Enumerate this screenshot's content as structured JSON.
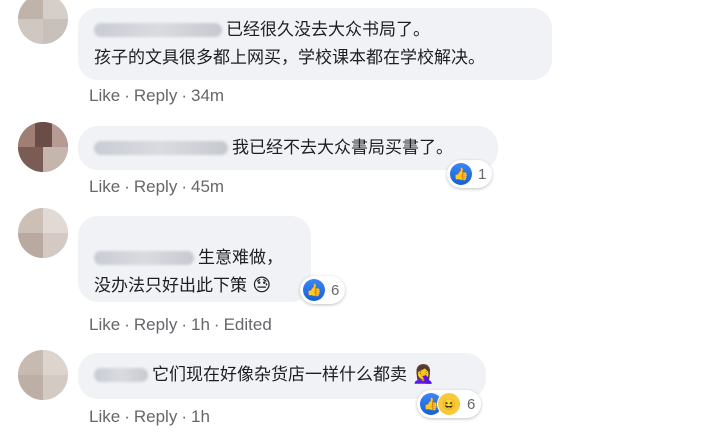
{
  "comments": [
    {
      "text_lines": [
        "已经很久没去大众书局了。",
        "孩子的文具很多都上网买，学校课本都在学校解决。"
      ],
      "actions": {
        "like": "Like",
        "reply": "Reply",
        "time": "34m"
      }
    },
    {
      "text_lines": [
        "我已经不去大众書局买書了。"
      ],
      "actions": {
        "like": "Like",
        "reply": "Reply",
        "time": "45m"
      },
      "reactions": {
        "count": "1",
        "icons": [
          "like-icon"
        ]
      }
    },
    {
      "text_lines": [
        "生意难做，",
        "没办法只好出此下策"
      ],
      "emoji": "😓",
      "actions": {
        "like": "Like",
        "reply": "Reply",
        "time": "1h",
        "edited": "Edited"
      },
      "reactions": {
        "count": "6",
        "icons": [
          "like-icon"
        ]
      }
    },
    {
      "text_lines": [
        "它们现在好像杂货店一样什么都卖"
      ],
      "emoji": "🤦‍♀️",
      "actions": {
        "like": "Like",
        "reply": "Reply",
        "time": "1h"
      },
      "reactions": {
        "count": "6",
        "icons": [
          "like-icon",
          "haha-icon"
        ]
      }
    }
  ],
  "colors": {
    "bubble": "#f0f2f5",
    "action_text": "#65676b",
    "like_blue": "#1877f2"
  }
}
